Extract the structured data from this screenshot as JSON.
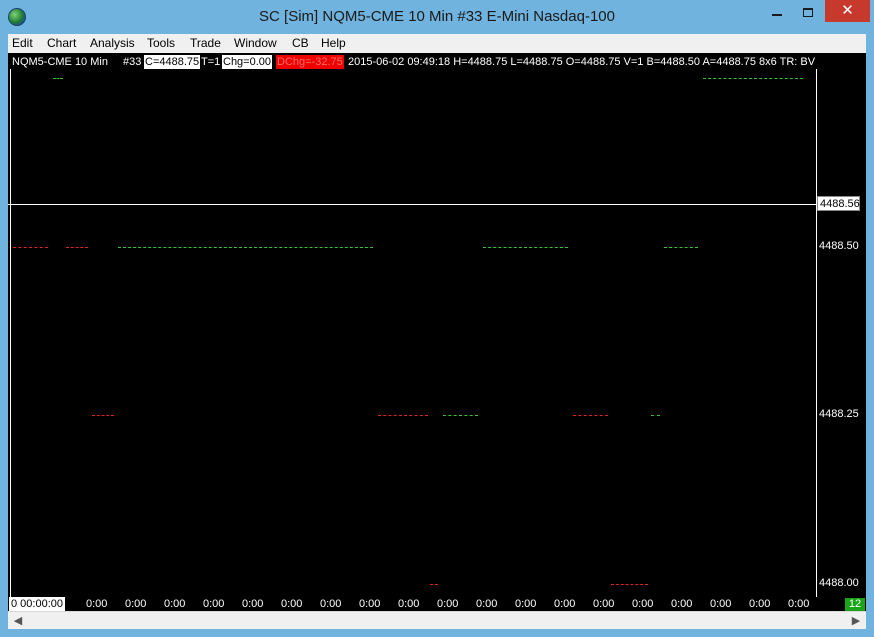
{
  "window": {
    "title": "SC [Sim] NQM5-CME  10 Min   #33  E-Mini Nasdaq-100",
    "close_glyph": "✕"
  },
  "menu": [
    "Edit",
    "Chart",
    "Analysis",
    "Tools",
    "Trade",
    "Window",
    "CB",
    "Help"
  ],
  "info": {
    "symbol": "NQM5-CME  10 Min",
    "chart_num": "#33",
    "close": "C=4488.75",
    "trades": "T=1",
    "chg": "Chg=0.00",
    "dchg": "DChg=-32.75",
    "details": "2015-06-02 09:49:18 H=4488.75 L=4488.75 O=4488.75 V=1 B=4488.50 A=4488.75 8x6 TR: BV"
  },
  "price_axis": {
    "current": "4488.56",
    "labels": [
      "4488.50",
      "4488.25",
      "4488.00"
    ]
  },
  "time_axis": {
    "first": "0  00:00:00",
    "label": "0:00",
    "count": 19
  },
  "counter": "12",
  "colors": {
    "up": "#35c435",
    "down": "#e02424",
    "background": "#000000",
    "title_bar": "#6fb3de"
  },
  "chart_data": {
    "type": "scatter",
    "ylim": [
      4488.0,
      4488.8
    ],
    "series": [
      {
        "color": "green",
        "points": [
          {
            "x_start": 45,
            "x_end": 55,
            "y": 4488.75
          },
          {
            "x_start": 695,
            "x_end": 795,
            "y": 4488.75
          },
          {
            "x_start": 110,
            "x_end": 365,
            "y": 4488.5
          },
          {
            "x_start": 475,
            "x_end": 560,
            "y": 4488.5
          },
          {
            "x_start": 656,
            "x_end": 690,
            "y": 4488.5
          },
          {
            "x_start": 435,
            "x_end": 470,
            "y": 4488.25
          },
          {
            "x_start": 643,
            "x_end": 652,
            "y": 4488.25
          }
        ]
      },
      {
        "color": "red",
        "points": [
          {
            "x_start": 5,
            "x_end": 40,
            "y": 4488.5
          },
          {
            "x_start": 58,
            "x_end": 80,
            "y": 4488.5
          },
          {
            "x_start": 84,
            "x_end": 106,
            "y": 4488.25
          },
          {
            "x_start": 370,
            "x_end": 420,
            "y": 4488.25
          },
          {
            "x_start": 565,
            "x_end": 600,
            "y": 4488.25
          },
          {
            "x_start": 422,
            "x_end": 430,
            "y": 4488.0
          },
          {
            "x_start": 603,
            "x_end": 640,
            "y": 4488.0
          }
        ]
      }
    ]
  }
}
